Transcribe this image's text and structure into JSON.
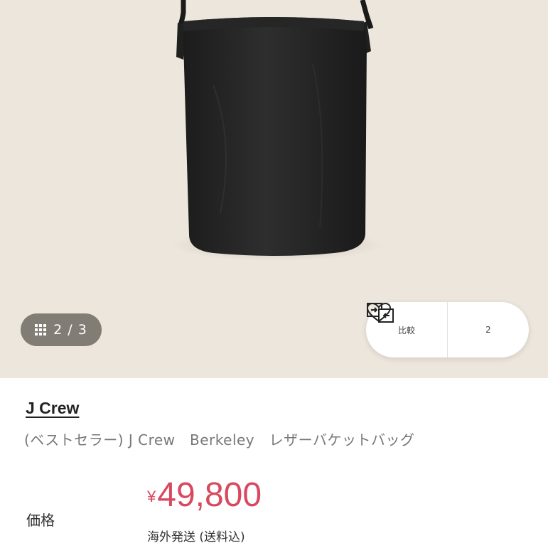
{
  "gallery": {
    "counter": "2 / 3",
    "grid_icon": "grid-icon",
    "compare_label": "比較",
    "favorite_count": "2"
  },
  "product": {
    "brand": "J Crew",
    "title": "(ベストセラー) J Crew　Berkeley　レザーバケットバッグ",
    "price_label": "価格",
    "price_currency": "¥",
    "price_amount": "49,800",
    "shipping_note": "海外発送 (送料込)",
    "price_color": "#d8495f"
  }
}
